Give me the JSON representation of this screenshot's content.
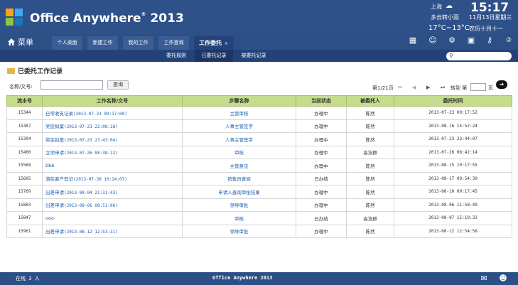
{
  "app": {
    "brand": "Office Anywhere",
    "reg": "®",
    "year": "2013"
  },
  "weather": {
    "city": "上海",
    "condition": "多云转小雨",
    "temp": "17°C~13°C"
  },
  "clock": {
    "time": "15:17",
    "date": "11月13日星期三",
    "lunar": "农历十月十一"
  },
  "nav": {
    "menu_label": "菜单",
    "tabs": [
      "个人桌面",
      "新建工作",
      "我的工作",
      "工作查询",
      "工作委托"
    ],
    "close": "×"
  },
  "subtabs": [
    "委托规则",
    "已委托记录",
    "被委托记录"
  ],
  "page": {
    "title": "已委托工作记录",
    "search_label": "名称/文号:",
    "query_btn": "查询"
  },
  "pager": {
    "info": "第1/21页",
    "goto": "转到 第",
    "page_unit": "页"
  },
  "table": {
    "headers": [
      "流水号",
      "工作名称/文号",
      "步骤名称",
      "当前状态",
      "被委托人",
      "委托时间"
    ],
    "rows": [
      {
        "id": "15344",
        "name": "日常收支记录",
        "ts": "(2013-07-23 09:17:00)",
        "step": "主管审核",
        "status": "办理中",
        "person": "陈然",
        "time": "2013-07-23 09:17:52"
      },
      {
        "id": "15387",
        "name": "奖惩拟案",
        "ts": "(2013-07-23 22:08:18)",
        "step": "人事主管签字",
        "status": "办理中",
        "person": "陈然",
        "time": "2013-08-16 15:52:24"
      },
      {
        "id": "15394",
        "name": "奖惩拟案",
        "ts": "(2013-07-23 23:43:04)",
        "step": "人事主管签字",
        "status": "办理中",
        "person": "陈然",
        "time": "2013-07-23 23:44:07"
      },
      {
        "id": "15460",
        "name": "立项申请",
        "ts": "(2013-07-26 08:38:12)",
        "step": "审核",
        "status": "办理中",
        "person": "高浩群",
        "time": "2013-07-26 08:42:14"
      },
      {
        "id": "15568",
        "name": "bbb",
        "ts": "",
        "step": "主管意见",
        "status": "办理中",
        "person": "陈然",
        "time": "2013-08-15 10:17:55"
      },
      {
        "id": "15605",
        "name": "潜在客户登记",
        "ts": "(2013-07-30 10:14:07)",
        "step": "销售员查阅",
        "status": "已办结",
        "person": "陈然",
        "time": "2013-08-17 09:54:30"
      },
      {
        "id": "15769",
        "name": "出差申请",
        "ts": "(2013-08-04 21:31:43)",
        "step": "申请人查询审批结果",
        "status": "办理中",
        "person": "陈然",
        "time": "2013-08-10 09:17:45"
      },
      {
        "id": "15803",
        "name": "出差申请",
        "ts": "(2013-08-06 08:51:06)",
        "step": "领导审批",
        "status": "办理中",
        "person": "陈然",
        "time": "2013-08-06 11:58:49"
      },
      {
        "id": "15847",
        "name": "ooo",
        "ts": "",
        "step": "审核",
        "status": "已办结",
        "person": "高浩群",
        "time": "2013-08-07 15:19:33"
      },
      {
        "id": "15961",
        "name": "出差申请",
        "ts": "(2013-08-12 12:53:31)",
        "step": "领导审批",
        "status": "办理中",
        "person": "陈然",
        "time": "2013-08-12 12:54:58"
      }
    ]
  },
  "footer": {
    "online": "在线 3 人",
    "brand": "Office Anywhere 2013"
  },
  "colors": {
    "header_bg": "#2e5189",
    "nav_bg": "#2c4f86",
    "sub_bg": "#23427a",
    "table_head": "#c5dc8c",
    "link": "#1a5db0"
  },
  "icons": [
    "home-icon",
    "layout-icon",
    "users-icon",
    "gear-icon",
    "bag-icon",
    "key-icon",
    "help-icon",
    "search-icon",
    "mail-icon",
    "people-icon",
    "cloud-icon",
    "folder-icon"
  ]
}
